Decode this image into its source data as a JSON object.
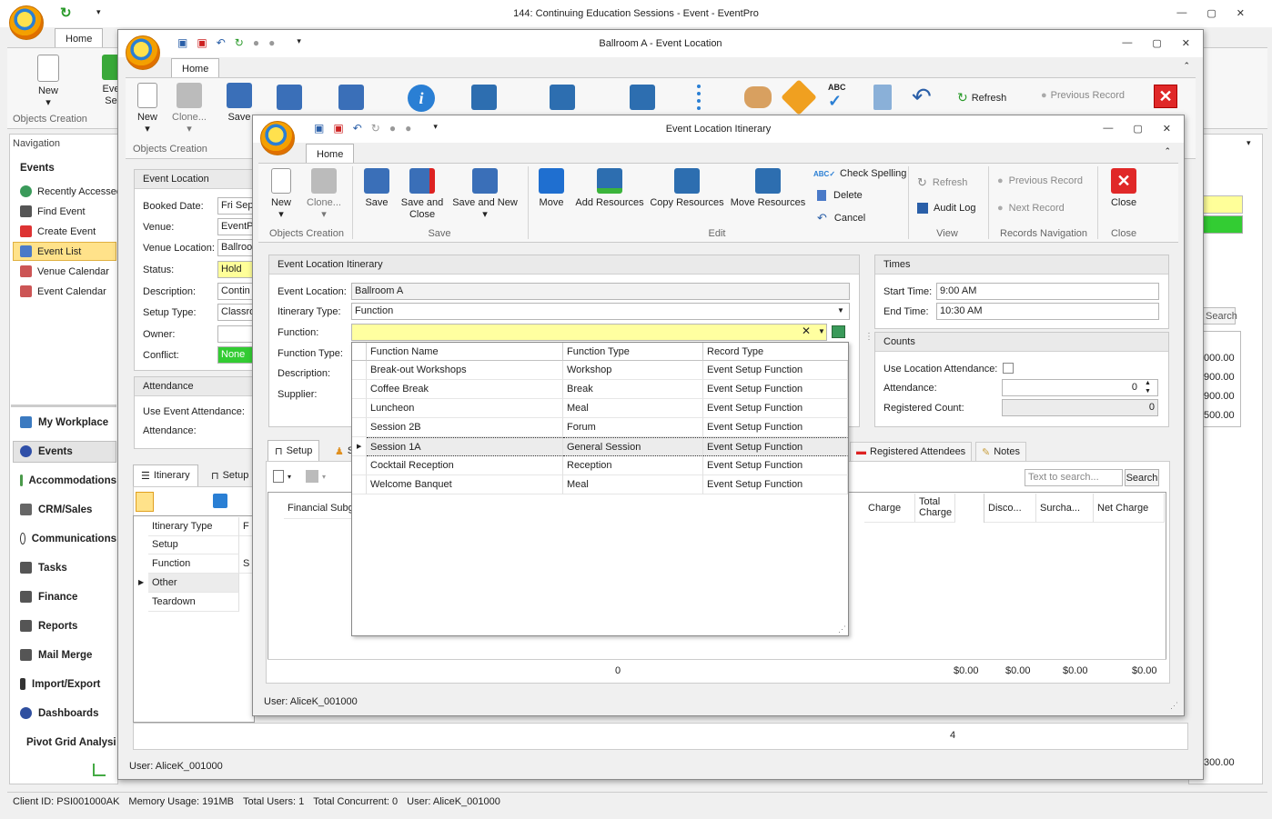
{
  "main": {
    "title": "144: Continuing Education Sessions - Event - EventPro",
    "tab": "Home",
    "new_label": "New",
    "eve_label": "Eve Se",
    "group": "Objects Creation",
    "nav_header": "Navigation",
    "nav_section": "Events",
    "nav_items": [
      "Recently Accessed",
      "Find Event",
      "Create Event",
      "Event List",
      "Venue Calendar",
      "Event Calendar"
    ],
    "nav_bottom": [
      "My Workplace",
      "Events",
      "Accommodations",
      "CRM/Sales",
      "Communications",
      "Tasks",
      "Finance",
      "Reports",
      "Mail Merge",
      "Import/Export",
      "Dashboards",
      "Pivot Grid Analysis"
    ],
    "right_search": "Search",
    "right_vals": [
      "000.00",
      "900.00",
      "900.00",
      "500.00"
    ],
    "right_bottom": "300.00",
    "status": [
      "Client ID: PSI001000AK",
      "Memory Usage: 191MB",
      "Total Users: 1",
      "Total Concurrent: 0",
      "User: AliceK_001000"
    ]
  },
  "loc": {
    "title": "Ballroom A - Event Location",
    "tab": "Home",
    "buttons": [
      "New",
      "Clone...",
      "Save"
    ],
    "group": "Objects Creation",
    "panel": "Event Location",
    "labels": [
      "Booked Date:",
      "Venue:",
      "Venue Location:",
      "Status:",
      "Description:",
      "Setup Type:",
      "Owner:",
      "Conflict:"
    ],
    "values": [
      "Fri Sep",
      "EventP",
      "Ballroo",
      "Hold",
      "Contin",
      "Classro",
      "",
      "None"
    ],
    "attendance": "Attendance",
    "att_labels": [
      "Use Event Attendance:",
      "Attendance:"
    ],
    "tabs": [
      "Itinerary",
      "Setup"
    ],
    "itin_header": "Itinerary Type",
    "itin_header2": "F",
    "itin_rows": [
      "Setup",
      "Function",
      "Other",
      "Teardown"
    ],
    "itin_row2": [
      "",
      "S",
      "",
      ""
    ],
    "count": "4",
    "status": "User: AliceK_001000",
    "top_right": [
      "Refresh",
      "Previous Record"
    ]
  },
  "itin": {
    "title": "Event Location Itinerary",
    "tab": "Home",
    "ribbon": {
      "new": "New",
      "clone": "Clone...",
      "save": "Save",
      "save_close": "Save and Close",
      "save_new": "Save and New",
      "move": "Move",
      "add_res": "Add Resources",
      "copy_res": "Copy Resources",
      "move_res": "Move Resources",
      "check": "Check Spelling",
      "delete": "Delete",
      "cancel": "Cancel",
      "refresh": "Refresh",
      "audit": "Audit Log",
      "prev": "Previous Record",
      "next": "Next Record",
      "close": "Close",
      "groups": [
        "Objects Creation",
        "Save",
        "Edit",
        "View",
        "Records Navigation",
        "Close"
      ]
    },
    "panel": "Event Location Itinerary",
    "labels": [
      "Event Location:",
      "Itinerary Type:",
      "Function:",
      "Function Type:",
      "Description:",
      "Supplier:"
    ],
    "event_location": "Ballroom A",
    "itinerary_type": "Function",
    "function": "",
    "times": {
      "title": "Times",
      "start_label": "Start Time:",
      "start": "9:00 AM",
      "end_label": "End Time:",
      "end": "10:30 AM"
    },
    "counts": {
      "title": "Counts",
      "use_label": "Use Location Attendance:",
      "att_label": "Attendance:",
      "att": "0",
      "reg_label": "Registered Count:",
      "reg": "0"
    },
    "tabs": [
      "Setup",
      "S",
      "Registered Attendees",
      "Notes"
    ],
    "search_placeholder": "Text to search...",
    "search_btn": "Search",
    "grid_headers": [
      "Financial Subgr",
      "Charge",
      "Total Charge",
      "Disco...",
      "Surcha...",
      "Net Charge"
    ],
    "totals": [
      "0",
      "$0.00",
      "$0.00",
      "$0.00",
      "$0.00"
    ],
    "status": "User: AliceK_001000"
  },
  "dropdown": {
    "headers": [
      "Function Name",
      "Function Type",
      "Record Type"
    ],
    "rows": [
      [
        "Break-out Workshops",
        "Workshop",
        "Event Setup Function"
      ],
      [
        "Coffee Break",
        "Break",
        "Event Setup Function"
      ],
      [
        "Luncheon",
        "Meal",
        "Event Setup Function"
      ],
      [
        "Session 2B",
        "Forum",
        "Event Setup Function"
      ],
      [
        "Session 1A",
        "General Session",
        "Event Setup Function"
      ],
      [
        "Cocktail Reception",
        "Reception",
        "Event Setup Function"
      ],
      [
        "Welcome Banquet",
        "Meal",
        "Event Setup Function"
      ]
    ]
  }
}
